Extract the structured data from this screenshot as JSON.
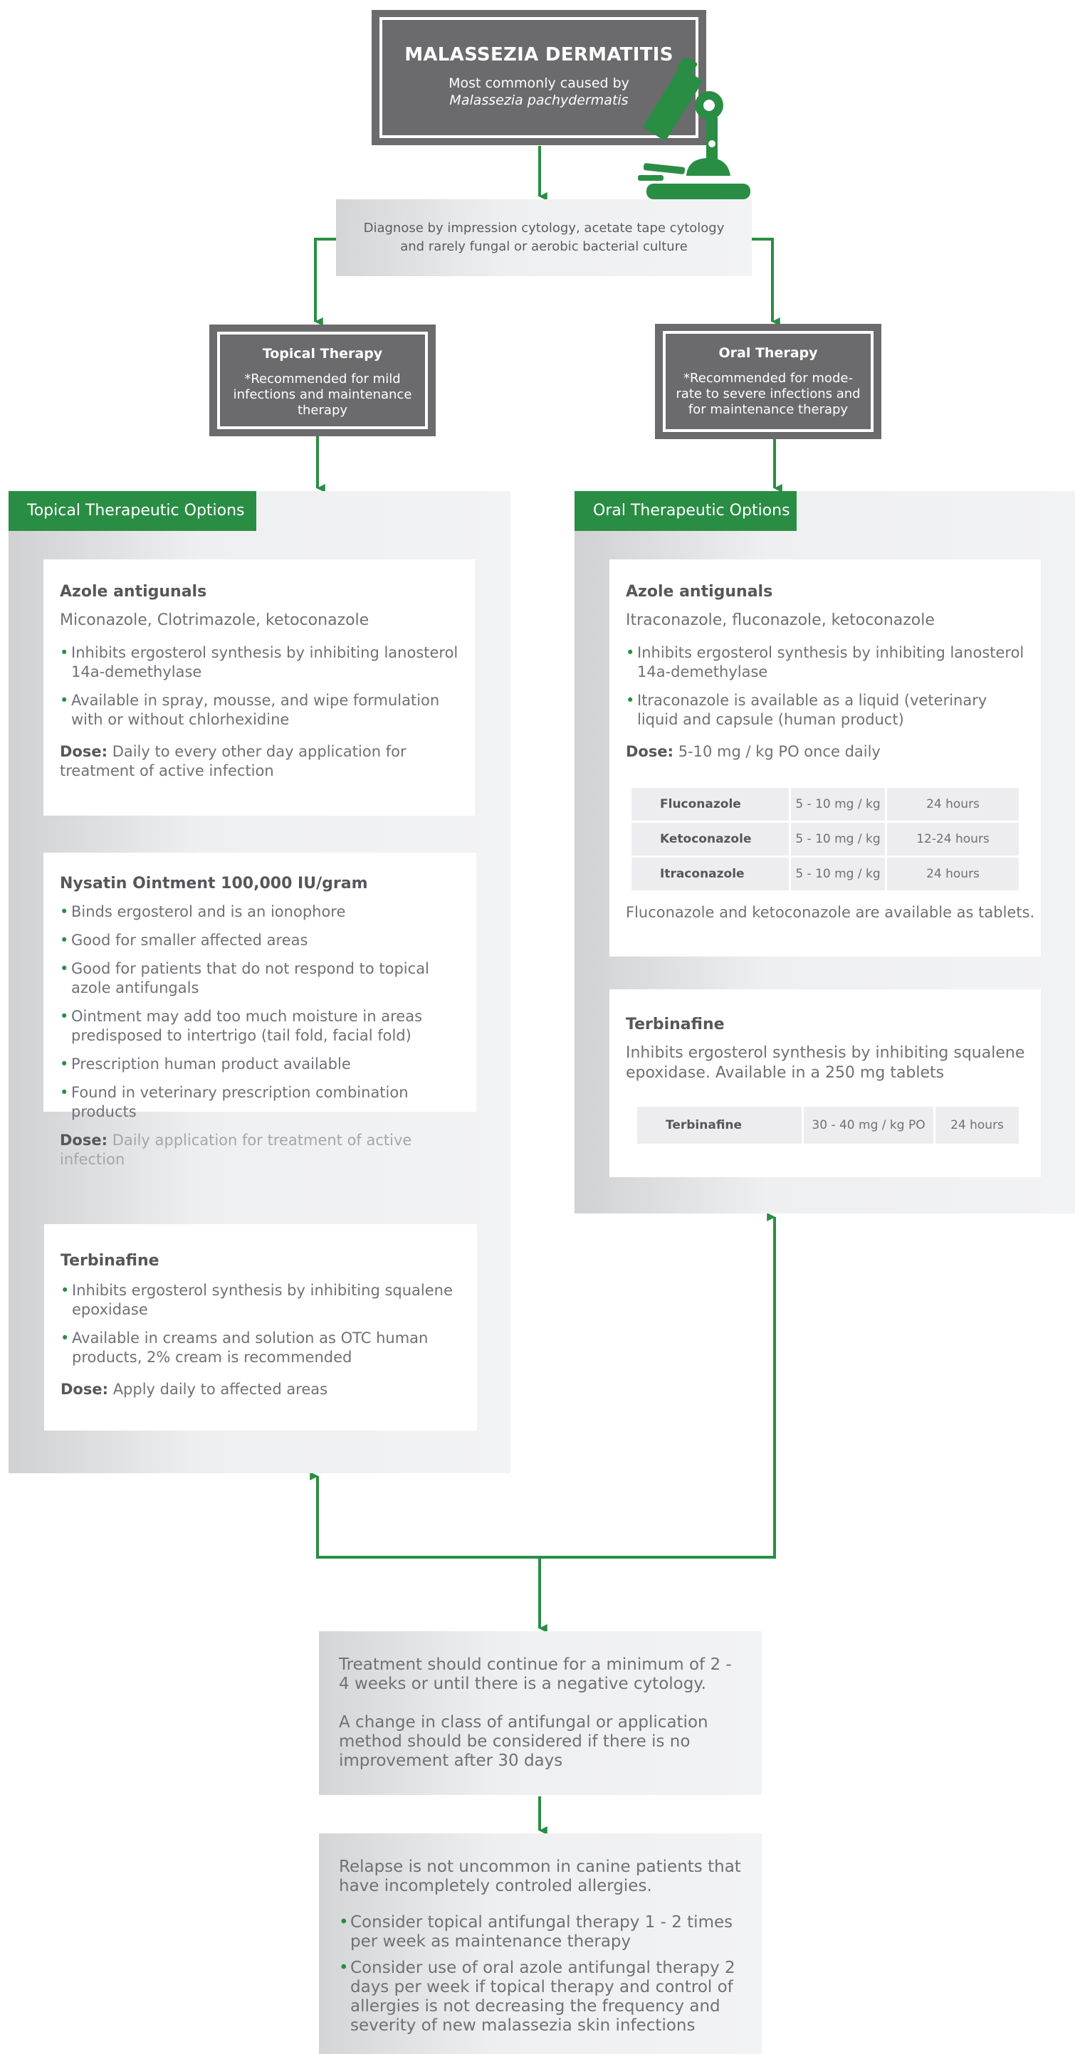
{
  "header": {
    "title": "MALASSEZIA DERMATITIS",
    "subtitle": "Most commonly caused by",
    "organism": "Malassezia pachydermatis"
  },
  "diagnose": {
    "text": "Diagnose by impression cytology, acetate tape cytology and rarely fungal or aerobic bacterial culture"
  },
  "topical_therapy": {
    "title": "Topical Therapy",
    "note": "*Recommended for mild infections and maintenance therapy"
  },
  "oral_therapy": {
    "title": "Oral Therapy",
    "note": "*Recommended for mode- rate to severe infections and for maintenance therapy"
  },
  "topical_options": {
    "label": "Topical Therapeutic Options",
    "azole": {
      "title": "Azole antigunals",
      "drugs": "Miconazole, Clotrimazole, ketoconazole",
      "bullets": [
        "Inhibits ergosterol synthesis by inhibiting lanosterol 14a-demethylase",
        "Available in spray, mousse, and wipe formulation with or without chlorhexidine"
      ],
      "dose_label": "Dose:",
      "dose_text": "Daily to every other day application for treatment of active infection"
    },
    "nystatin": {
      "title": "Nysatin Ointment 100,000 IU/gram",
      "bullets": [
        "Binds ergosterol and is an ionophore",
        "Good for smaller affected areas",
        "Good for patients that do not respond to topical azole antifungals",
        "Ointment may add too much moisture in areas predisposed to intertrigo (tail fold, facial fold)",
        "Prescription human product available",
        "Found in veterinary  prescription combination products"
      ],
      "dose_label": "Dose:",
      "dose_text": "Daily application for treatment of active infection"
    },
    "terbinafine": {
      "title": "Terbinafine",
      "bullets": [
        "Inhibits ergosterol synthesis by inhibiting squalene epoxidase",
        "Available in creams and solution as OTC human products, 2% cream is recommended"
      ],
      "dose_label": "Dose:",
      "dose_text": "Apply daily to affected areas"
    }
  },
  "oral_options": {
    "label": "Oral Therapeutic Options",
    "azole": {
      "title": "Azole antigunals",
      "drugs": "Itraconazole, fluconazole, ketoconazole",
      "bullets": [
        "Inhibits ergosterol synthesis by inhibiting lanosterol 14a-demethylase",
        "Itraconazole is available as a liquid (veterinary liquid and capsule (human product)"
      ],
      "dose_label": "Dose:",
      "dose_text": "5-10 mg / kg PO once daily",
      "table": [
        [
          "Fluconazole",
          "5 - 10 mg / kg",
          "24 hours"
        ],
        [
          "Ketoconazole",
          "5 - 10 mg / kg",
          "12-24 hours"
        ],
        [
          "Itraconazole",
          "5 - 10 mg / kg",
          "24 hours"
        ]
      ],
      "note": "Fluconazole and ketoconazole are available as tablets."
    },
    "terbinafine": {
      "title": "Terbinafine",
      "text": "Inhibits ergosterol synthesis by inhibiting squalene epoxidase. Available in a 250 mg tablets",
      "table": [
        [
          "Terbinafine",
          "30 - 40 mg / kg PO",
          "24 hours"
        ]
      ]
    }
  },
  "treatment": {
    "p1": "Treatment should continue for a minimum of 2 - 4 weeks or until there is a negative cytology.",
    "p2": "A change in class of antifungal or application method should be considered if there is no improvement after 30 days"
  },
  "relapse": {
    "intro": "Relapse is not uncommon in canine patients that have incompletely controled allergies.",
    "bullets": [
      "Consider topical antifungal therapy 1 - 2 times per week as maintenance therapy",
      "Consider use of oral azole antifungal therapy 2 days per week if topical therapy and control of allergies is not decreasing the frequency and severity of new malassezia skin infections"
    ]
  },
  "colors": {
    "green": "#2a8d44",
    "dark_gray": "#6b6b6d",
    "panel_gray": "#eeeff1"
  },
  "icons": {
    "microscope": "microscope-icon"
  }
}
